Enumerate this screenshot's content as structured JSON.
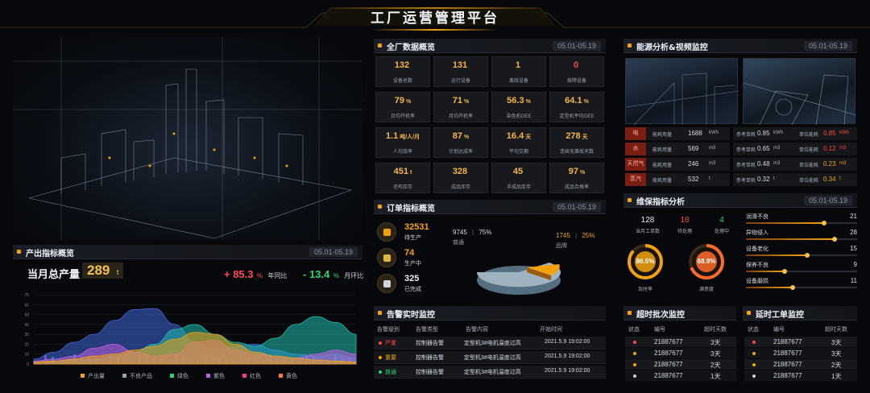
{
  "title": "工厂运营管理平台",
  "colors": {
    "accent": "#f3a20e",
    "red": "#ff4a3a",
    "green": "#2ed17a",
    "teal": "#20c0b0"
  },
  "overview": {
    "title": "全厂数据概览",
    "date": "05.01-05.19",
    "cards": [
      {
        "v": "132",
        "u": "",
        "l": "设备总数"
      },
      {
        "v": "131",
        "u": "",
        "l": "运行设备"
      },
      {
        "v": "1",
        "u": "",
        "l": "离线设备"
      },
      {
        "v": "0",
        "u": "",
        "l": "故障设备"
      },
      {
        "v": "79",
        "u": "%",
        "l": "日均开机率"
      },
      {
        "v": "71",
        "u": "%",
        "l": "月均开机率"
      },
      {
        "v": "56.3",
        "u": "%",
        "l": "染色机OEE"
      },
      {
        "v": "64.1",
        "u": "%",
        "l": "定型机平均OEE"
      },
      {
        "v": "1.1",
        "u": "吨/人/月",
        "l": "人均效率"
      },
      {
        "v": "87",
        "u": "%",
        "l": "计划达成率"
      },
      {
        "v": "16.4",
        "u": "天",
        "l": "平均交期"
      },
      {
        "v": "278",
        "u": "天",
        "l": "连续无事故天数"
      },
      {
        "v": "451",
        "u": "t",
        "l": "坯布库存"
      },
      {
        "v": "328",
        "u": "",
        "l": "成品库存"
      },
      {
        "v": "45",
        "u": "",
        "l": "半成品库存"
      },
      {
        "v": "97",
        "u": "%",
        "l": "成品合格率"
      }
    ]
  },
  "orders": {
    "title": "订单指标概览",
    "date": "05.01-05.19",
    "items": [
      {
        "v": "32531",
        "l": "待生产"
      },
      {
        "v": "74",
        "l": "生产中"
      },
      {
        "v": "325",
        "l": "已完成"
      }
    ],
    "normal": {
      "count": "9745",
      "sep": "|",
      "pct": "75%",
      "label": "普通"
    },
    "brand": {
      "count": "1745",
      "sep": "|",
      "pct": "25%",
      "label": "品牌"
    }
  },
  "alarms": {
    "title": "告警实时监控",
    "cols": [
      "告警级别",
      "告警类型",
      "告警内容",
      "开始时间"
    ],
    "rows": [
      {
        "level": "严重",
        "color": "#ff4a3a",
        "type": "控制器告警",
        "content": "定型机3#电机温度过高",
        "time": "2021.5.9 19:02:00"
      },
      {
        "level": "重要",
        "color": "#f3a20e",
        "type": "控制器告警",
        "content": "定型机3#电机温度过高",
        "time": "2021.5.9 19:02:00"
      },
      {
        "level": "普通",
        "color": "#2ed17a",
        "type": "控制器告警",
        "content": "定型机3#电机温度过高",
        "time": "2021.5.9 19:02:00"
      }
    ]
  },
  "output": {
    "title": "产出指标概览",
    "date": "05.01-05.19",
    "label": "当月总产量",
    "value": "289",
    "unit": "t",
    "yoy": {
      "v": "+ 85.3",
      "u": "%",
      "l": "年同比"
    },
    "mom": {
      "v": "- 13.4",
      "u": "%",
      "l": "月环比"
    },
    "legend": [
      "产出量",
      "不良产品",
      "绿色",
      "紫色",
      "红色",
      "黄色"
    ]
  },
  "chart_data": {
    "type": "area",
    "ylim": [
      0,
      70
    ],
    "yticks": [
      "70",
      "60",
      "50",
      "40",
      "30",
      "20",
      "10",
      "0"
    ],
    "series": [
      {
        "color": "#3f66d9",
        "values": [
          5,
          12,
          22,
          30,
          44,
          55,
          56,
          40,
          22,
          15,
          18,
          20,
          14,
          10,
          8,
          10,
          6
        ]
      },
      {
        "color": "#20c0b0",
        "values": [
          2,
          3,
          4,
          5,
          8,
          12,
          20,
          35,
          40,
          30,
          22,
          18,
          26,
          40,
          48,
          42,
          30
        ]
      },
      {
        "color": "#c061e0",
        "values": [
          3,
          5,
          8,
          16,
          20,
          12,
          8,
          10,
          22,
          24,
          14,
          10,
          8,
          6,
          10,
          14,
          10
        ]
      },
      {
        "color": "#f3a20e",
        "values": [
          2,
          3,
          5,
          8,
          10,
          14,
          18,
          25,
          32,
          30,
          20,
          12,
          8,
          6,
          4,
          3,
          2
        ]
      }
    ]
  },
  "energy": {
    "title": "能源分析&视频监控",
    "date": "05.01-05.19",
    "rows": [
      {
        "tag": "电",
        "l": "能耗用量",
        "v": "1688",
        "u": "kWh",
        "r": "参考单耗",
        "rv": "0.85",
        "ru": "kWh",
        "c": "单位能耗",
        "cv": "0.85",
        "cu": "kWh"
      },
      {
        "tag": "水",
        "l": "能耗用量",
        "v": "569",
        "u": "m3",
        "r": "参考单耗",
        "rv": "0.65",
        "ru": "m3",
        "c": "单位能耗",
        "cv": "0.12",
        "cu": "m3"
      },
      {
        "tag": "天然气",
        "l": "能耗用量",
        "v": "246",
        "u": "m3",
        "r": "参考单耗",
        "rv": "0.48",
        "ru": "m3",
        "c": "单位能耗",
        "cv": "0.23",
        "cu": "m3"
      },
      {
        "tag": "蒸汽",
        "l": "能耗用量",
        "v": "532",
        "u": "t",
        "r": "参考单耗",
        "rv": "0.32",
        "ru": "t",
        "c": "单位能耗",
        "cv": "0.34",
        "cu": "t"
      }
    ]
  },
  "maint": {
    "title": "维保指标分析",
    "date": "05.01-05.19",
    "stats": [
      {
        "v": "128",
        "l": "当月工单数"
      },
      {
        "v": "18",
        "l": "待处理"
      },
      {
        "v": "4",
        "l": "处理中"
      }
    ],
    "rings": [
      {
        "v": "86.5%",
        "l": "及时率",
        "pct": 86.5
      },
      {
        "v": "68.9%",
        "l": "满意度",
        "pct": 68.9
      }
    ],
    "bars": [
      {
        "l": "润滑不良",
        "v": "21",
        "p": 0.7
      },
      {
        "l": "异物侵入",
        "v": "28",
        "p": 0.8
      },
      {
        "l": "设备老化",
        "v": "15",
        "p": 0.55
      },
      {
        "l": "保养不良",
        "v": "9",
        "p": 0.35
      },
      {
        "l": "设备磨损",
        "v": "11",
        "p": 0.42
      }
    ]
  },
  "overtime": {
    "title": "超时批次监控",
    "cols": [
      "状态",
      "编号",
      "超时天数"
    ],
    "rows": [
      {
        "c": "#ff4a3a",
        "id": "21887677",
        "d": "3天"
      },
      {
        "c": "#f3a20e",
        "id": "21887677",
        "d": "3天"
      },
      {
        "c": "#f3a20e",
        "id": "21887677",
        "d": "2天"
      },
      {
        "c": "#cfd3da",
        "id": "21887677",
        "d": "1天"
      }
    ]
  },
  "delay": {
    "title": "延时工单监控",
    "cols": [
      "状态",
      "编号",
      "超时天数"
    ],
    "rows": [
      {
        "c": "#ff4a3a",
        "id": "21887677",
        "d": "3天"
      },
      {
        "c": "#f3a20e",
        "id": "21887677",
        "d": "3天"
      },
      {
        "c": "#f3a20e",
        "id": "21887677",
        "d": "2天"
      },
      {
        "c": "#cfd3da",
        "id": "21887677",
        "d": "1天"
      }
    ]
  }
}
